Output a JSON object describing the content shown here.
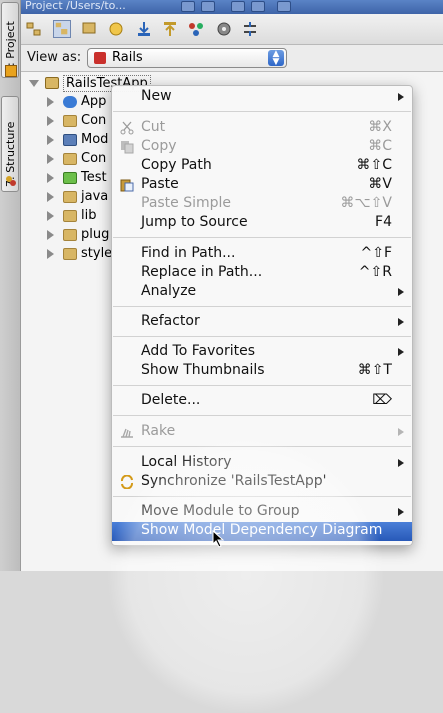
{
  "toolstrip": {
    "tab1_label": "1: Project",
    "tab2_label": "7: Structure"
  },
  "panel": {
    "title": "Project /Users/to...",
    "view_as_label": "View as:",
    "view_as_value": "Rails"
  },
  "tree": {
    "root": "RailsTestApp",
    "children": [
      "App",
      "Con",
      "Mod",
      "Con",
      "Test",
      "java",
      "lib",
      "plug",
      "style"
    ]
  },
  "menu": {
    "items": [
      {
        "label": "New",
        "shortcut": "",
        "submenu": true,
        "disabled": false
      },
      {
        "label": "Cut",
        "shortcut": "⌘X",
        "submenu": false,
        "disabled": true
      },
      {
        "label": "Copy",
        "shortcut": "⌘C",
        "submenu": false,
        "disabled": true
      },
      {
        "label": "Copy Path",
        "shortcut": "⌘⇧C",
        "submenu": false,
        "disabled": false
      },
      {
        "label": "Paste",
        "shortcut": "⌘V",
        "submenu": false,
        "disabled": false
      },
      {
        "label": "Paste Simple",
        "shortcut": "⌘⌥⇧V",
        "submenu": false,
        "disabled": true
      },
      {
        "label": "Jump to Source",
        "shortcut": "F4",
        "submenu": false,
        "disabled": false
      },
      {
        "label": "Find in Path...",
        "shortcut": "^⇧F",
        "submenu": false,
        "disabled": false
      },
      {
        "label": "Replace in Path...",
        "shortcut": "^⇧R",
        "submenu": false,
        "disabled": false
      },
      {
        "label": "Analyze",
        "shortcut": "",
        "submenu": true,
        "disabled": false
      },
      {
        "label": "Refactor",
        "shortcut": "",
        "submenu": true,
        "disabled": false
      },
      {
        "label": "Add To Favorites",
        "shortcut": "",
        "submenu": true,
        "disabled": false
      },
      {
        "label": "Show Thumbnails",
        "shortcut": "⌘⇧T",
        "submenu": false,
        "disabled": false
      },
      {
        "label": "Delete...",
        "shortcut": "⌦",
        "submenu": false,
        "disabled": false
      },
      {
        "label": "Rake",
        "shortcut": "",
        "submenu": true,
        "disabled": true
      },
      {
        "label": "Local History",
        "shortcut": "",
        "submenu": true,
        "disabled": false
      },
      {
        "label": "Synchronize 'RailsTestApp'",
        "shortcut": "",
        "submenu": false,
        "disabled": false
      },
      {
        "label": "Move Module to Group",
        "shortcut": "",
        "submenu": true,
        "disabled": false
      },
      {
        "label": "Show Model Dependency Diagram",
        "shortcut": "",
        "submenu": false,
        "disabled": false,
        "highlighted": true
      }
    ]
  },
  "colors": {
    "highlight": "#2f62c0",
    "title_bar": "#4b72b8"
  }
}
